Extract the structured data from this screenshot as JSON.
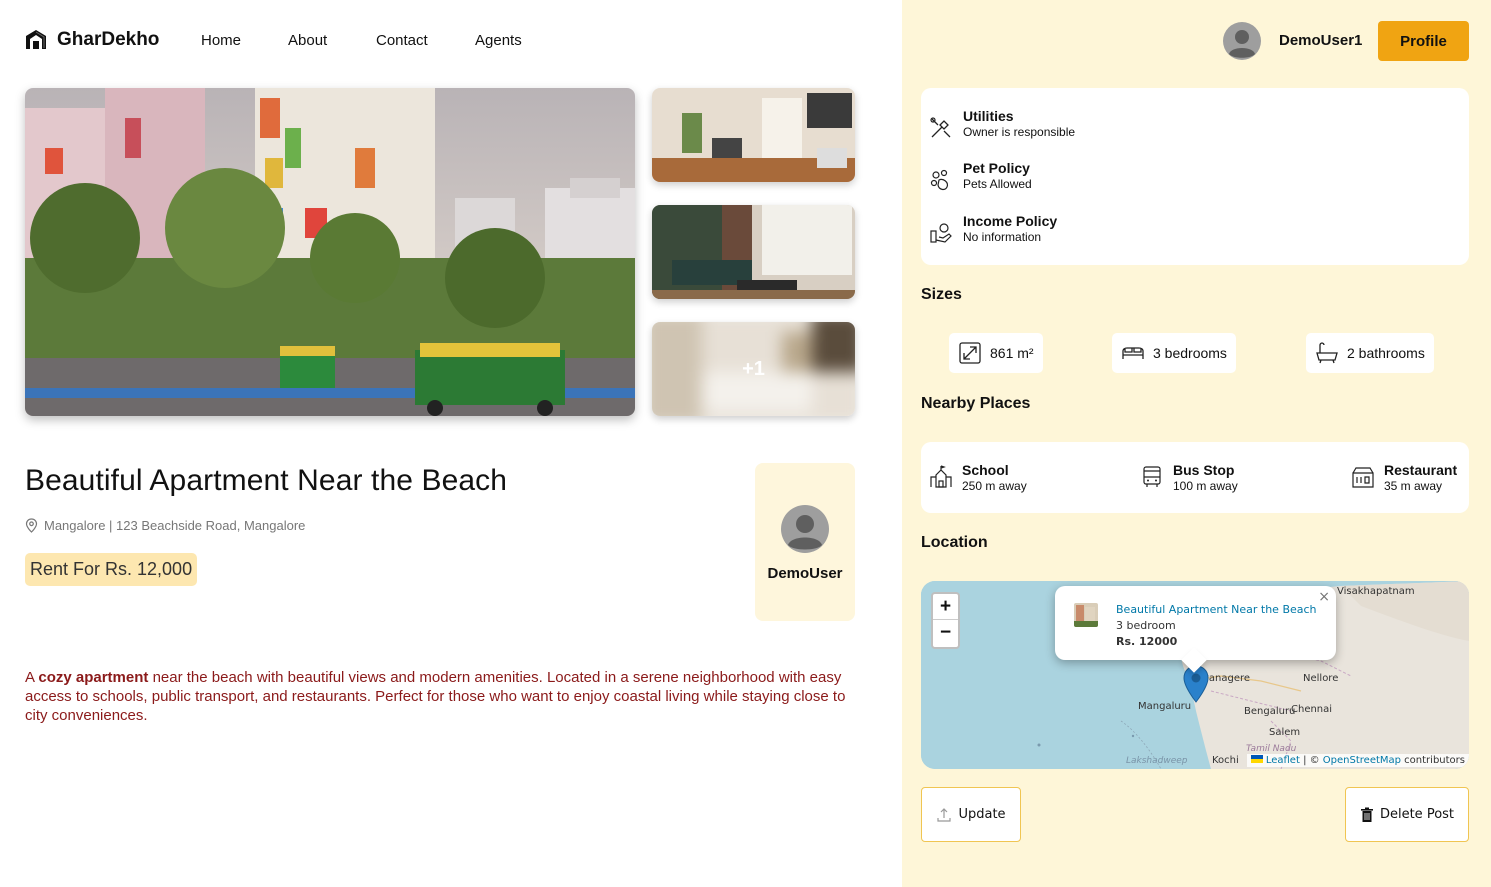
{
  "brand": {
    "name": "GharDekho"
  },
  "nav": {
    "items": [
      "Home",
      "About",
      "Contact",
      "Agents"
    ]
  },
  "header": {
    "username": "DemoUser1",
    "profile_label": "Profile"
  },
  "gallery": {
    "more_count": "+1"
  },
  "listing": {
    "title": "Beautiful Apartment Near the Beach",
    "address": "Mangalore | 123 Beachside Road, Mangalore",
    "price": "Rent For Rs. 12,000",
    "owner": "DemoUser",
    "description_highlight": "A ",
    "description_bold": "cozy apartment",
    "description_rest": " near the beach with beautiful views and modern amenities. Located in a serene neighborhood with easy access to schools, public transport, and restaurants. Perfect for those who want to enjoy coastal living while staying close to city conveniences."
  },
  "policies": [
    {
      "title": "Utilities",
      "value": "Owner is responsible",
      "icon": "tools-icon"
    },
    {
      "title": "Pet Policy",
      "value": "Pets Allowed",
      "icon": "paw-icon"
    },
    {
      "title": "Income Policy",
      "value": "No information",
      "icon": "income-icon"
    }
  ],
  "sizes": {
    "title": "Sizes",
    "area": "861 m²",
    "bedrooms": "3 bedrooms",
    "bathrooms": "2 bathrooms"
  },
  "nearby": {
    "title": "Nearby Places",
    "items": [
      {
        "name": "School",
        "distance": "250 m away",
        "icon": "school-icon"
      },
      {
        "name": "Bus Stop",
        "distance": "100 m away",
        "icon": "bus-icon"
      },
      {
        "name": "Restaurant",
        "distance": "35 m away",
        "icon": "restaurant-icon"
      }
    ]
  },
  "location": {
    "title": "Location",
    "zoom_in": "+",
    "zoom_out": "−",
    "popup_title": "Beautiful Apartment Near the Beach",
    "popup_bedrooms": "3 bedroom",
    "popup_price": "Rs. 12000",
    "popup_close": "×",
    "labels": {
      "visakhapatnam": "Visakhapatnam",
      "davanagere": "vanagere",
      "nellore": "Nellore",
      "mangaluru": "Mangaluru",
      "bengaluru": "Bengaluru",
      "chennai": "Chennai",
      "salem": "Salem",
      "tamilnadu": "Tamil Nadu",
      "lakshadweep": "Lakshadweep",
      "kochi": "Kochi"
    },
    "attribution_leaflet": "Leaflet",
    "attribution_sep": " | © ",
    "attribution_osm": "OpenStreetMap",
    "attribution_rest": " contributors"
  },
  "actions": {
    "update_label": "Update",
    "delete_label": "Delete Post"
  },
  "colors": {
    "accent": "#f0a412",
    "panel": "#fef6d8",
    "price_bg": "#fde7b0",
    "desc_text": "#8b1a1a",
    "link": "#0078a8"
  }
}
